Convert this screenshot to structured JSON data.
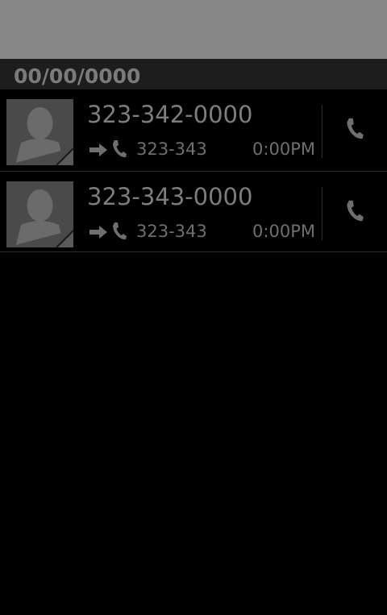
{
  "date_header": "00/00/0000",
  "calls": [
    {
      "number": "323-342-0000",
      "sub_number": "323-343",
      "time": "0:00PM",
      "direction": "outgoing-arrow-icon"
    },
    {
      "number": "323-343-0000",
      "sub_number": "323-343",
      "time": "0:00PM",
      "direction": "outgoing-arrow-icon"
    }
  ],
  "colors": {
    "top_bar": "#878787",
    "header_bg": "#1d1d1d",
    "text_primary": "#7d7d7d",
    "text_secondary": "#6f6f6f",
    "avatar_bg": "#4a4a4a"
  }
}
